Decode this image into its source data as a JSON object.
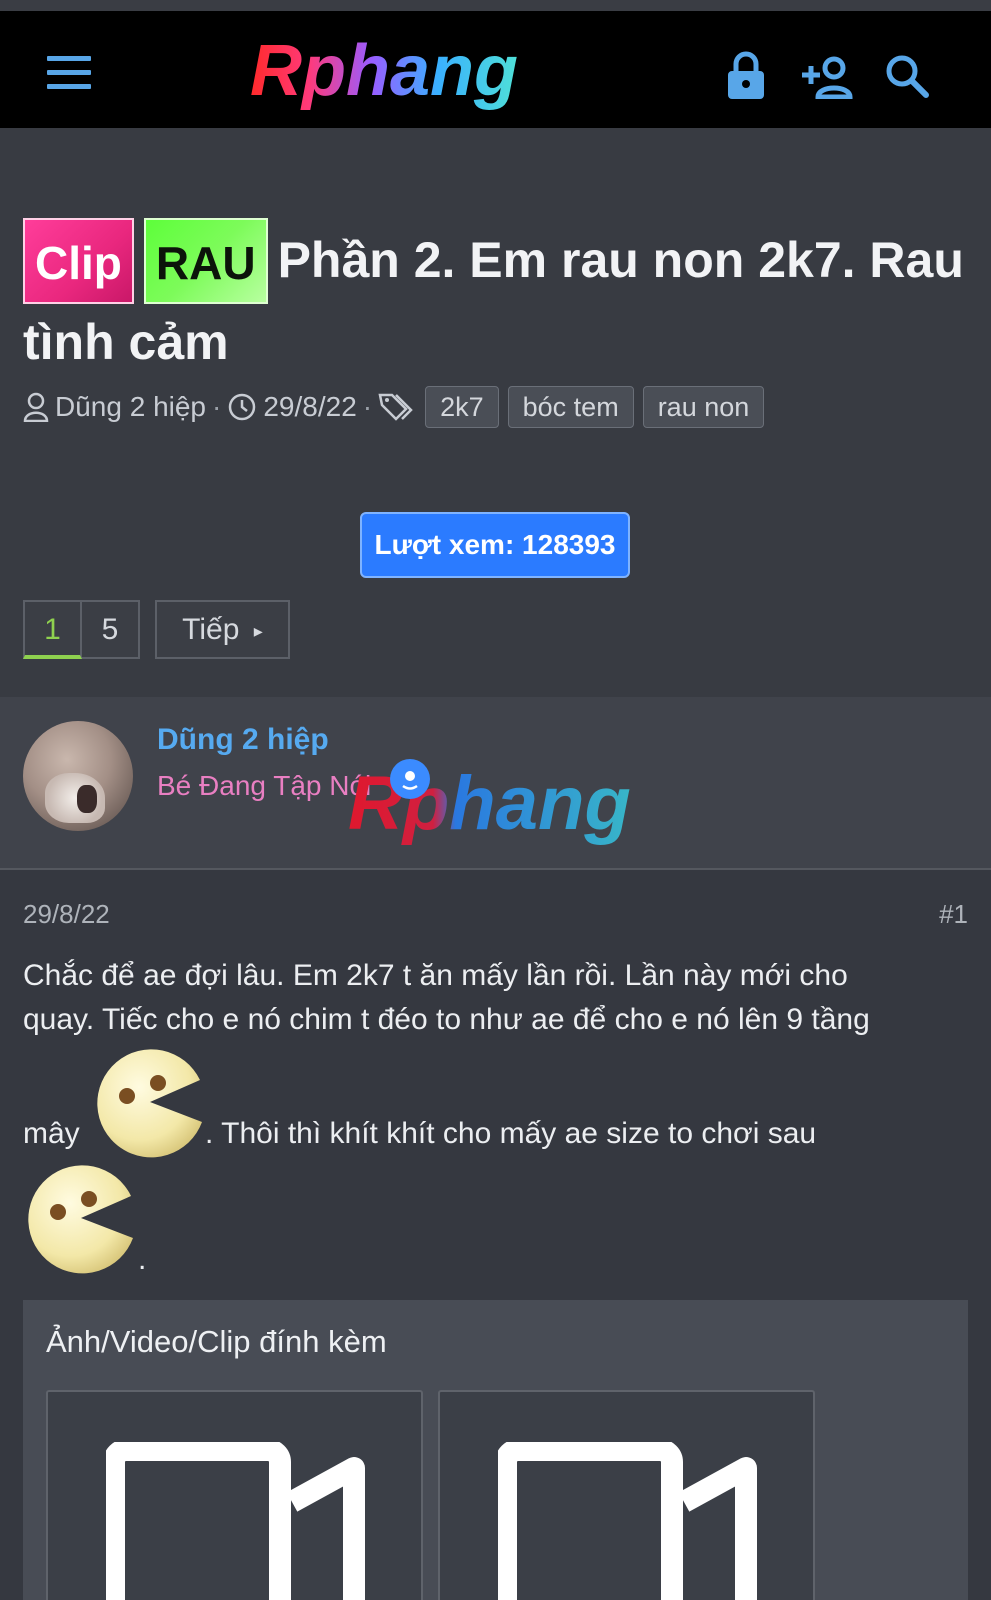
{
  "header": {
    "logo_text": "Rphang",
    "icons": [
      "menu-icon",
      "lock-icon",
      "add-user-icon",
      "search-icon"
    ],
    "colors": {
      "background": "#000000",
      "icon": "#58a6e8"
    }
  },
  "thread": {
    "prefix_clip": "Clip",
    "prefix_rau": "RAU",
    "title": "Phần 2. Em rau non 2k7. Rau tình cảm",
    "author": "Dũng 2 hiệp",
    "date": "29/8/22",
    "tags": [
      "2k7",
      "bóc tem",
      "rau non"
    ],
    "views_label": "Lượt xem: 128393"
  },
  "pagination": {
    "current": "1",
    "last": "5",
    "next_label": "Tiếp"
  },
  "post": {
    "author_name": "Dũng 2 hiệp",
    "author_title": "Bé Đang Tập Nói",
    "watermark": "Rphang",
    "date": "29/8/22",
    "number": "#1",
    "text_line1": "Chắc để ae đợi lâu. Em 2k7 t ăn mấy lần rồi. Lần này mới cho",
    "text_line2": "quay. Tiếc cho e nó chim t đéo to như ae để cho e nó lên 9 tầng",
    "text_line3a": "mây",
    "text_line3b": ". Thôi thì khít khít cho mấy ae size to chơi sau",
    "text_line4": ".",
    "smilies": [
      "pacman-smiley-icon",
      "pacman-smiley-icon"
    ]
  },
  "attachments": {
    "title": "Ảnh/Video/Clip đính kèm",
    "items": [
      "video-icon",
      "video-icon"
    ]
  }
}
